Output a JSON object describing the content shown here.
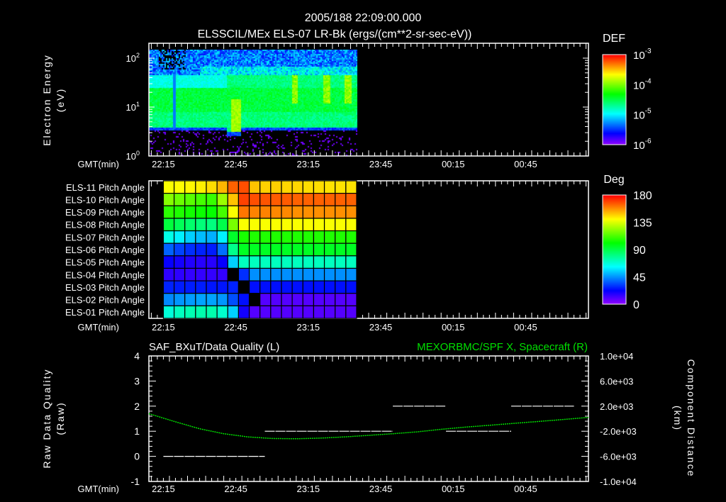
{
  "header": {
    "datetime": "2005/188 22:09:00.000",
    "title": "ELSSCIL/MEx ELS-07 LR-Bk  (ergs/(cm**2-sr-sec-eV))"
  },
  "time_axis": {
    "label": "GMT(min)",
    "start": "22:09",
    "end": "01:11",
    "ticks": [
      "22:15",
      "22:45",
      "23:15",
      "23:45",
      "00:15",
      "00:45"
    ]
  },
  "chart_data": [
    {
      "type": "heatmap",
      "name": "electron-spectrogram",
      "title": "ELSSCIL/MEx ELS-07 LR-Bk  (ergs/(cm**2-sr-sec-eV))",
      "ylabel": "Electron Energy",
      "yunit": "(eV)",
      "yscale": "log",
      "ylim": [
        1,
        145
      ],
      "y_ticks": [
        {
          "base": "10",
          "exp": "2"
        },
        {
          "base": "10",
          "exp": "1"
        },
        {
          "base": "10",
          "exp": "0"
        }
      ],
      "data_time_range": [
        "22:15",
        "23:35"
      ],
      "colorbar": {
        "label": "DEF",
        "range_log10": [
          -6,
          -3
        ],
        "ticks": [
          {
            "base": "10",
            "exp": "-3"
          },
          {
            "base": "10",
            "exp": "-4"
          },
          {
            "base": "10",
            "exp": "-5"
          },
          {
            "base": "10",
            "exp": "-6"
          }
        ]
      }
    },
    {
      "type": "heatmap",
      "name": "pitch-angle",
      "data_time_range": [
        "22:15",
        "23:35"
      ],
      "rows": [
        {
          "label": "ELS-11 Pitch Angle",
          "values": [
            140,
            141,
            142,
            143,
            146,
            152,
            165,
            168,
            150,
            148,
            148,
            147,
            147,
            146,
            146,
            145,
            145,
            145
          ]
        },
        {
          "label": "ELS-10 Pitch Angle",
          "values": [
            122,
            118,
            115,
            112,
            110,
            125,
            150,
            170,
            168,
            167,
            166,
            166,
            165,
            165,
            165,
            165,
            165,
            165
          ]
        },
        {
          "label": "ELS-09 Pitch Angle",
          "values": [
            108,
            106,
            104,
            103,
            102,
            112,
            140,
            162,
            160,
            160,
            159,
            159,
            158,
            158,
            158,
            158,
            158,
            158
          ]
        },
        {
          "label": "ELS-08 Pitch Angle",
          "values": [
            92,
            88,
            85,
            83,
            82,
            90,
            120,
            140,
            140,
            140,
            140,
            140,
            140,
            140,
            140,
            140,
            140,
            140
          ]
        },
        {
          "label": "ELS-07 Pitch Angle",
          "values": [
            66,
            60,
            55,
            52,
            50,
            60,
            95,
            105,
            106,
            106,
            106,
            106,
            106,
            106,
            106,
            106,
            106,
            106
          ]
        },
        {
          "label": "ELS-06 Pitch Angle",
          "values": [
            38,
            33,
            30,
            28,
            27,
            40,
            80,
            96,
            96,
            96,
            96,
            96,
            96,
            96,
            96,
            96,
            96,
            96
          ]
        },
        {
          "label": "ELS-05 Pitch Angle",
          "values": [
            22,
            20,
            18,
            17,
            17,
            22,
            55,
            72,
            72,
            72,
            72,
            72,
            72,
            72,
            72,
            72,
            72,
            72
          ]
        },
        {
          "label": "ELS-04 Pitch Angle",
          "values": [
            16,
            16,
            15,
            15,
            15,
            15,
            null,
            30,
            45,
            45,
            45,
            45,
            45,
            45,
            45,
            45,
            45,
            45
          ]
        },
        {
          "label": "ELS-03 Pitch Angle",
          "values": [
            28,
            27,
            27,
            27,
            26,
            26,
            28,
            null,
            25,
            25,
            25,
            25,
            25,
            25,
            25,
            25,
            25,
            25
          ]
        },
        {
          "label": "ELS-02 Pitch Angle",
          "values": [
            44,
            46,
            47,
            48,
            48,
            46,
            35,
            25,
            null,
            10,
            10,
            10,
            10,
            10,
            10,
            10,
            10,
            10
          ]
        },
        {
          "label": "ELS-01 Pitch Angle",
          "values": [
            68,
            72,
            74,
            75,
            75,
            70,
            55,
            20,
            10,
            10,
            10,
            10,
            10,
            10,
            10,
            10,
            10,
            10
          ]
        }
      ],
      "colorbar": {
        "label": "Deg",
        "range": [
          0,
          180
        ],
        "ticks": [
          "180",
          "135",
          "90",
          "45",
          "0"
        ]
      }
    },
    {
      "type": "line",
      "name": "data-quality-and-position",
      "left_title": "SAF_BXuT/Data Quality (L)",
      "right_title": "MEXORBMC/SPF X, Spacecraft (R)",
      "right_title_color": "#00e000",
      "ylabel_left": "Raw Data Quality",
      "ylabel_left_unit": "(Raw)",
      "ylabel_right": "Component Distance",
      "ylabel_right_unit": "(km)",
      "ylim_left": [
        -1,
        4
      ],
      "y_ticks_left": [
        "4",
        "3",
        "2",
        "1",
        "0",
        "-1"
      ],
      "ylim_right": [
        -10000,
        10000
      ],
      "y_ticks_right": [
        "1.0e+04",
        "6.0e+03",
        "2.0e+03",
        "-2.0e+03",
        "-6.0e+03",
        "-1.0e+04"
      ],
      "quality_segments": [
        {
          "start": "22:15",
          "end": "22:57",
          "value": 0
        },
        {
          "start": "22:57",
          "end": "23:50",
          "value": 1
        },
        {
          "start": "23:50",
          "end": "00:12",
          "value": 2
        },
        {
          "start": "00:12",
          "end": "00:39",
          "value": 1
        },
        {
          "start": "00:39",
          "end": "01:05",
          "value": 2
        }
      ],
      "spacecraft_x_km": [
        [
          "22:09",
          800
        ],
        [
          "22:20",
          -500
        ],
        [
          "22:30",
          -1600
        ],
        [
          "22:40",
          -2400
        ],
        [
          "22:50",
          -2900
        ],
        [
          "23:00",
          -3150
        ],
        [
          "23:10",
          -3200
        ],
        [
          "23:20",
          -3100
        ],
        [
          "23:30",
          -2900
        ],
        [
          "23:40",
          -2650
        ],
        [
          "23:50",
          -2400
        ],
        [
          "00:00",
          -2100
        ],
        [
          "00:10",
          -1700
        ],
        [
          "00:20",
          -1350
        ],
        [
          "00:30",
          -1050
        ],
        [
          "00:40",
          -750
        ],
        [
          "00:50",
          -450
        ],
        [
          "01:00",
          -150
        ],
        [
          "01:11",
          200
        ]
      ]
    }
  ]
}
